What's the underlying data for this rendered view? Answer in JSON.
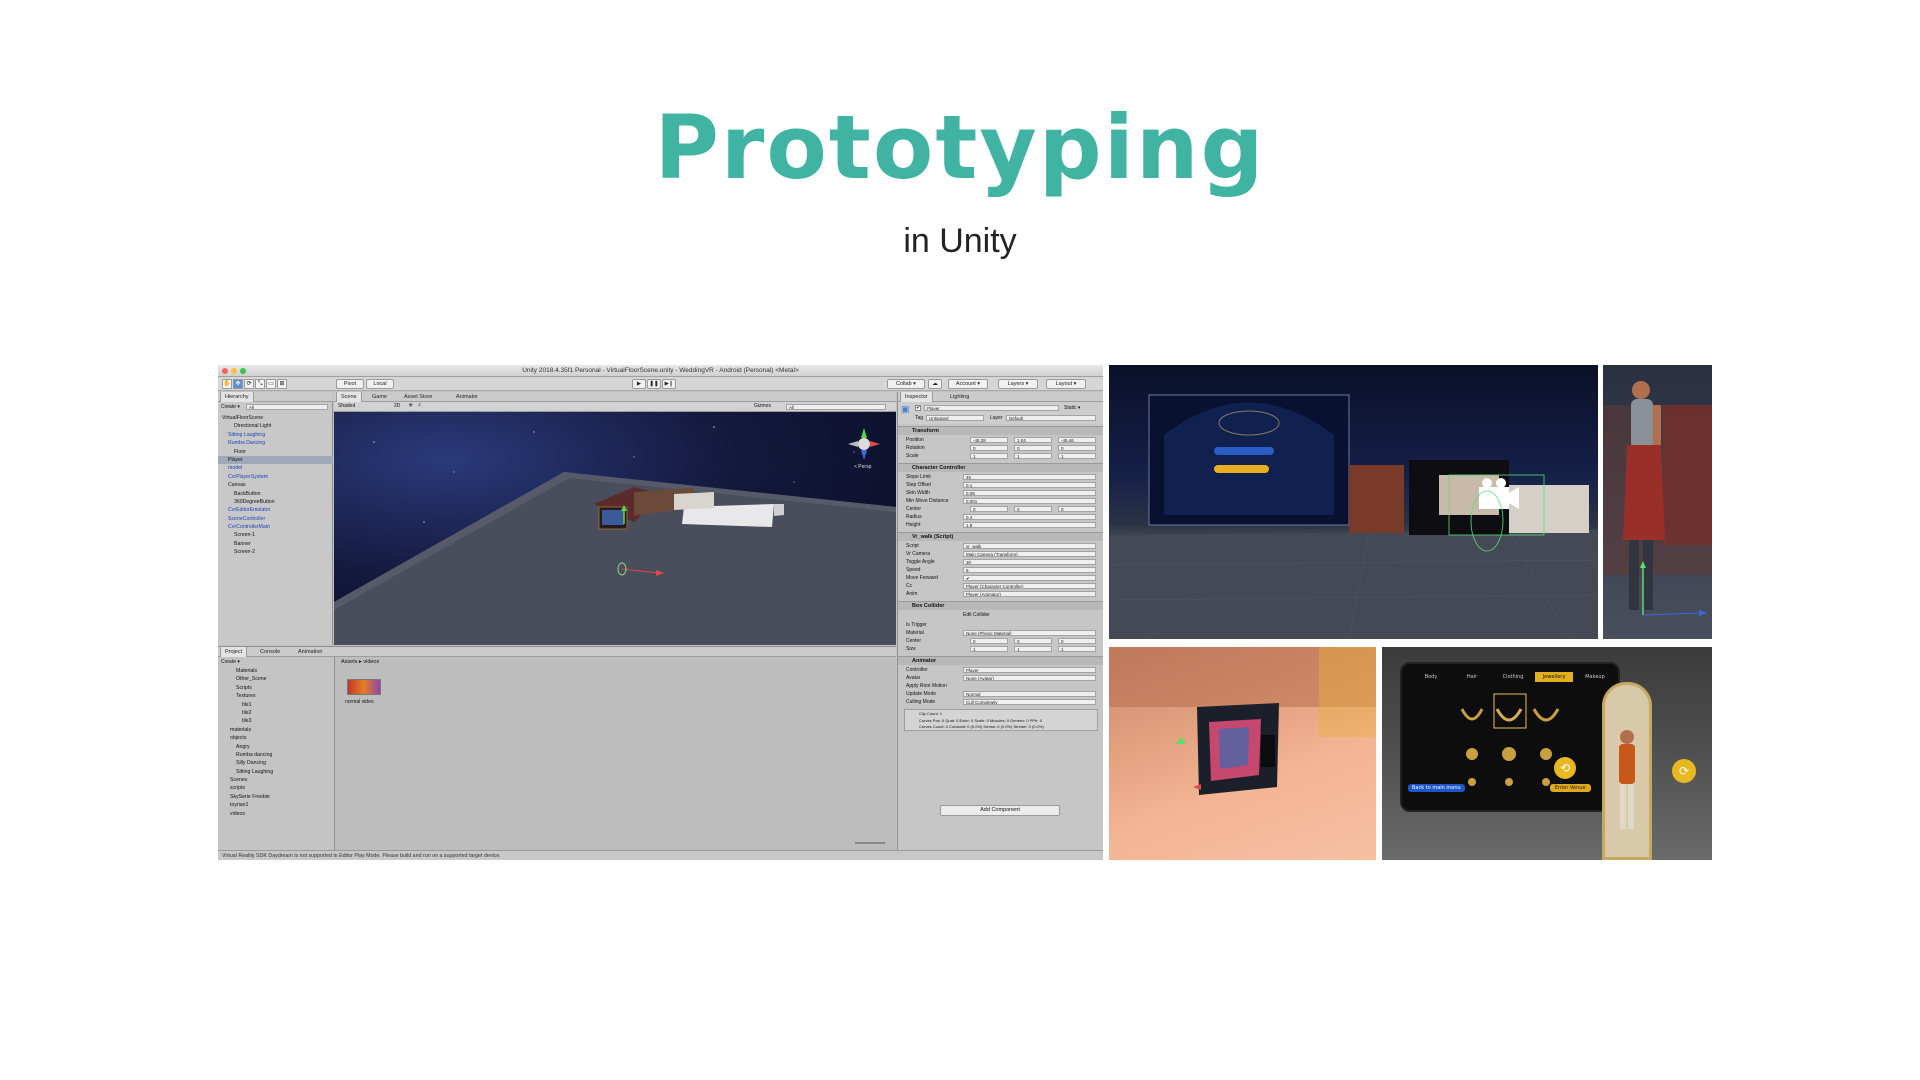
{
  "slide": {
    "title": "Prototyping",
    "subtitle": "in Unity",
    "accent_color": "#41b3a3"
  },
  "unity": {
    "window_title": "Unity 2018.4.35f1 Personal - VirtualFloorScene.unity - WeddingVR - Android (Personal) <Metal>",
    "toolbar": {
      "pivot": "Pivot",
      "local": "Local",
      "collab": "Collab ▾",
      "account": "Account ▾",
      "layers": "Layers ▾",
      "layout": "Layout ▾"
    },
    "hierarchy": {
      "tab": "Hierarchy",
      "create": "Create ▾",
      "search_placeholder": "All",
      "items": [
        {
          "label": "VirtualFloorScene",
          "indent": 0,
          "color": "normal"
        },
        {
          "label": "Directional Light",
          "indent": 2,
          "color": "normal"
        },
        {
          "label": "Sitting Laughing",
          "indent": 1,
          "color": "blue"
        },
        {
          "label": "Rumba Dancing",
          "indent": 1,
          "color": "blue"
        },
        {
          "label": "Floor",
          "indent": 2,
          "color": "normal"
        },
        {
          "label": "Player",
          "indent": 1,
          "color": "selected"
        },
        {
          "label": "model",
          "indent": 1,
          "color": "blue"
        },
        {
          "label": "CvrPlayerSystem",
          "indent": 1,
          "color": "blue"
        },
        {
          "label": "Canvas",
          "indent": 1,
          "color": "normal"
        },
        {
          "label": "BackButton",
          "indent": 2,
          "color": "normal"
        },
        {
          "label": "360DegreeButton",
          "indent": 2,
          "color": "normal"
        },
        {
          "label": "CvrEditorEmulator",
          "indent": 1,
          "color": "blue"
        },
        {
          "label": "SceneController",
          "indent": 1,
          "color": "blue"
        },
        {
          "label": "CvrControllerMain",
          "indent": 1,
          "color": "blue"
        },
        {
          "label": "Screen-1",
          "indent": 2,
          "color": "normal"
        },
        {
          "label": "Banner",
          "indent": 2,
          "color": "normal"
        },
        {
          "label": "Screen-2",
          "indent": 2,
          "color": "normal"
        }
      ]
    },
    "scene": {
      "tabs": [
        "Scene",
        "Game",
        "Asset Store",
        "Animator"
      ],
      "shaded": "Shaded",
      "mode_2d": "2D",
      "gizmos": "Gizmos",
      "search_placeholder": "All",
      "persp_label": "< Persp"
    },
    "inspector": {
      "tabs": [
        "Inspector",
        "Lighting"
      ],
      "object_name": "Player",
      "static": "Static ▾",
      "tag_label": "Tag",
      "tag_value": "Untagged",
      "layer_label": "Layer",
      "layer_value": "Default",
      "transform": {
        "header": "Transform",
        "position_label": "Position",
        "position": {
          "x": "-48.38",
          "y": "1.04",
          "z": "-49.46"
        },
        "rotation_label": "Rotation",
        "rotation": {
          "x": "0",
          "y": "0",
          "z": "0"
        },
        "scale_label": "Scale",
        "scale": {
          "x": "1",
          "y": "1",
          "z": "1"
        }
      },
      "character_controller": {
        "header": "Character Controller",
        "rows": [
          {
            "label": "Slope Limit",
            "value": "45"
          },
          {
            "label": "Step Offset",
            "value": "0.1"
          },
          {
            "label": "Skin Width",
            "value": "0.08"
          },
          {
            "label": "Min Move Distance",
            "value": "0.001"
          }
        ],
        "center_label": "Center",
        "center": {
          "x": "0",
          "y": "0",
          "z": "0"
        },
        "radius_label": "Radius",
        "radius": "0.4",
        "height_label": "Height",
        "height": "1.8"
      },
      "vr_walk": {
        "header": "Vr_walk (Script)",
        "rows": [
          {
            "label": "Script",
            "value": "vr_walk"
          },
          {
            "label": "Vr Camera",
            "value": "Main Camera (Transform)"
          },
          {
            "label": "Toggle Angle",
            "value": "30"
          },
          {
            "label": "Speed",
            "value": "6"
          },
          {
            "label": "Move Forward",
            "value": "✔"
          },
          {
            "label": "Cc",
            "value": "Player (Character Controller)"
          },
          {
            "label": "Anim",
            "value": "Player (Animator)"
          }
        ]
      },
      "box_collider": {
        "header": "Box Collider",
        "edit_collider": "Edit Collider",
        "is_trigger_label": "Is Trigger",
        "material_label": "Material",
        "material_value": "None (Physic Material)",
        "center_label": "Center",
        "center": {
          "x": "0",
          "y": "0",
          "z": "0"
        },
        "size_label": "Size",
        "size": {
          "x": "1",
          "y": "1",
          "z": "1"
        }
      },
      "animator": {
        "header": "Animator",
        "rows": [
          {
            "label": "Controller",
            "value": "Player"
          },
          {
            "label": "Avatar",
            "value": "None (Avatar)"
          },
          {
            "label": "Apply Root Motion",
            "value": ""
          },
          {
            "label": "Update Mode",
            "value": "Normal"
          },
          {
            "label": "Culling Mode",
            "value": "Cull Completely"
          }
        ],
        "info_line1": "Clip Count: 1",
        "info_line2": "Curves Pos: 0 Quat: 0 Euler: 0 Scale: 0 Muscles: 0 Generic: 0 PPtr: 0",
        "info_line3": "Curves Count: 0 Constant: 0 (0.0%) Dense: 0 (0.0%) Stream: 0 (0.0%)"
      },
      "add_component": "Add Component"
    },
    "project": {
      "tabs": [
        "Project",
        "Console",
        "Animation"
      ],
      "create": "Create ▾",
      "breadcrumb_root": "Assets",
      "breadcrumb_sep": "▸",
      "breadcrumb_folder": "videos",
      "asset_label": "normal video",
      "tree": [
        {
          "label": "Materials",
          "indent": 2
        },
        {
          "label": "Other_Scene",
          "indent": 2
        },
        {
          "label": "Scripts",
          "indent": 2
        },
        {
          "label": "Textures",
          "indent": 2
        },
        {
          "label": "tile1",
          "indent": 3
        },
        {
          "label": "tile2",
          "indent": 3
        },
        {
          "label": "tile3",
          "indent": 3
        },
        {
          "label": "materials",
          "indent": 1
        },
        {
          "label": "objects",
          "indent": 1
        },
        {
          "label": "Angry",
          "indent": 2
        },
        {
          "label": "Rumba dancing",
          "indent": 2
        },
        {
          "label": "Silly Dancing",
          "indent": 2
        },
        {
          "label": "Sitting Laughing",
          "indent": 2
        },
        {
          "label": "Scenes",
          "indent": 1
        },
        {
          "label": "scripts",
          "indent": 1
        },
        {
          "label": "SkySerie Freebie",
          "indent": 1
        },
        {
          "label": "toyrian1",
          "indent": 1
        },
        {
          "label": "videos",
          "indent": 1
        }
      ]
    },
    "status": "Virtual Reality SDK Daydream is not supported in Editor Play Mode. Please build and run on a supported target device."
  },
  "previews": {
    "menu_tabs": [
      "Body",
      "Hair",
      "Clothing",
      "Jewellery",
      "Makeup"
    ],
    "menu_active": "Jewellery",
    "back_button": "Back to main menu",
    "enter_button": "Enter Venue",
    "screen_button": "360-degree view"
  }
}
